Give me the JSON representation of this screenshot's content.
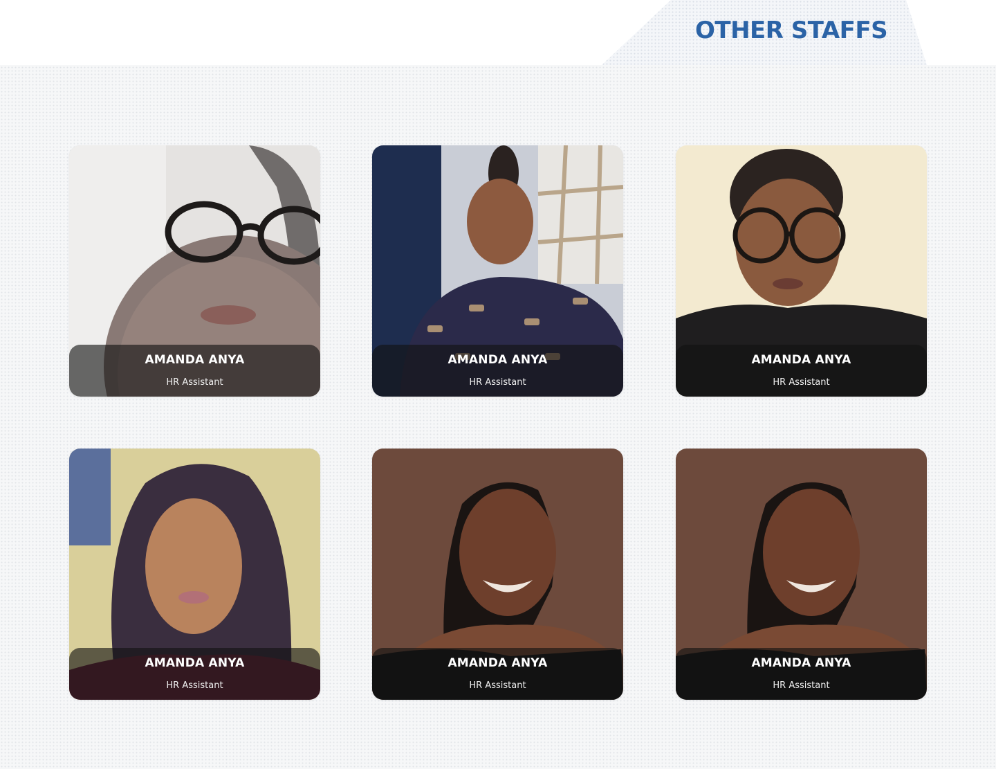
{
  "header": {
    "title": "OTHER STAFFS"
  },
  "staff": [
    {
      "name": "AMANDA ANYA",
      "role": "HR Assistant",
      "photo": "portrait-woman-glasses-selfie"
    },
    {
      "name": "AMANDA ANYA",
      "role": "HR Assistant",
      "photo": "portrait-woman-top-bun"
    },
    {
      "name": "AMANDA ANYA",
      "role": "HR Assistant",
      "photo": "portrait-woman-round-glasses"
    },
    {
      "name": "AMANDA ANYA",
      "role": "HR Assistant",
      "photo": "portrait-woman-wavy-hair"
    },
    {
      "name": "AMANDA ANYA",
      "role": "HR Assistant",
      "photo": "portrait-woman-smiling-braids"
    },
    {
      "name": "AMANDA ANYA",
      "role": "HR Assistant",
      "photo": "portrait-woman-smiling-braids"
    }
  ],
  "colors": {
    "title": "#2b63a6",
    "caption_overlay": "#121212",
    "caption_text": "#ffffff"
  }
}
